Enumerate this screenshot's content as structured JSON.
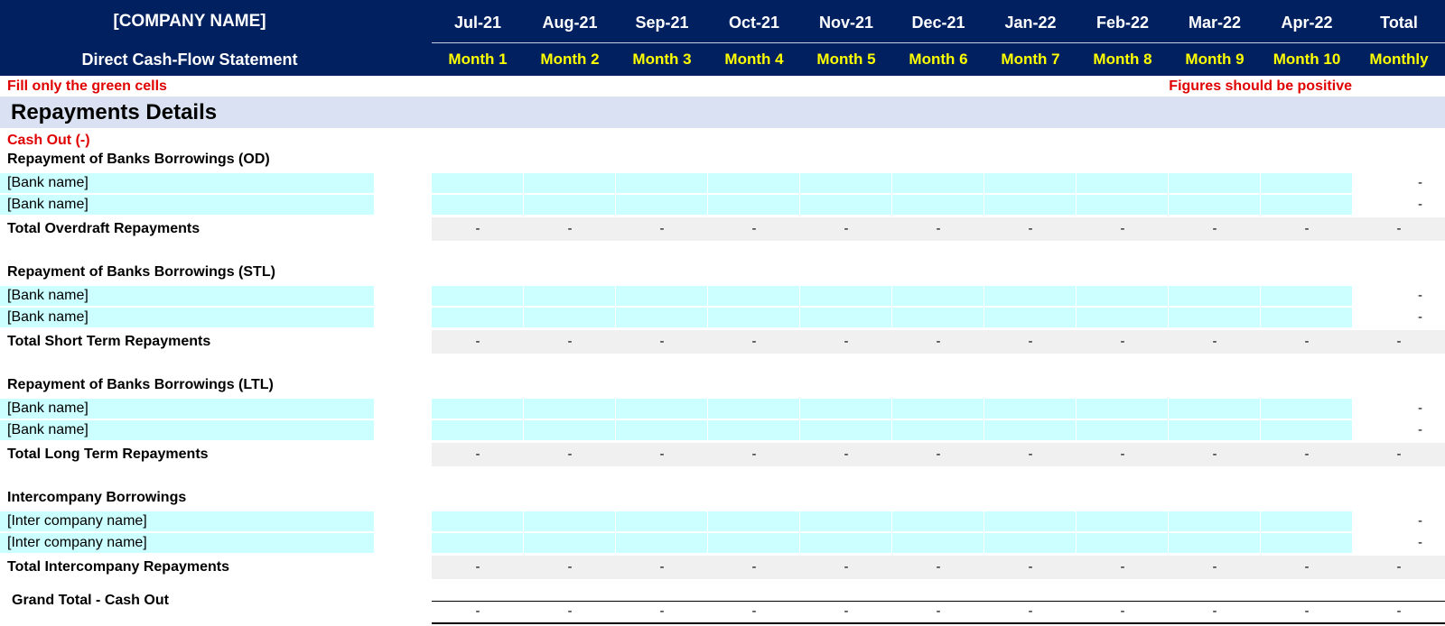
{
  "header": {
    "company": "[COMPANY NAME]",
    "subtitle": "Direct Cash-Flow Statement",
    "months": [
      "Jul-21",
      "Aug-21",
      "Sep-21",
      "Oct-21",
      "Nov-21",
      "Dec-21",
      "Jan-22",
      "Feb-22",
      "Mar-22",
      "Apr-22"
    ],
    "month_numbers": [
      "Month 1",
      "Month 2",
      "Month 3",
      "Month 4",
      "Month 5",
      "Month 6",
      "Month 7",
      "Month 8",
      "Month 9",
      "Month 10"
    ],
    "total_label": "Total",
    "total_sub": "Monthly"
  },
  "notes": {
    "left": "Fill only the green cells",
    "right": "Figures should be positive"
  },
  "section": {
    "title": "Repayments Details",
    "cash_out": "Cash Out (-)"
  },
  "groups": [
    {
      "title": "Repayment of Banks Borrowings (OD)",
      "rows": [
        "[Bank name]",
        "[Bank name]"
      ],
      "total_label": "Total Overdraft Repayments"
    },
    {
      "title": "Repayment of Banks Borrowings (STL)",
      "rows": [
        "[Bank name]",
        "[Bank name]"
      ],
      "total_label": "Total Short Term Repayments"
    },
    {
      "title": "Repayment of Banks Borrowings (LTL)",
      "rows": [
        "[Bank name]",
        "[Bank name]"
      ],
      "total_label": "Total Long Term Repayments"
    },
    {
      "title": "Intercompany Borrowings",
      "rows": [
        "[Inter company name]",
        "[Inter company name]"
      ],
      "total_label": "Total Intercompany Repayments"
    }
  ],
  "grand_total": {
    "label": "Grand Total - Cash Out"
  },
  "empty_value": "-",
  "colors": {
    "header_bg": "#002060",
    "month_number": "#ffff00",
    "input_cell": "#ccffff",
    "total_row_bg": "#f0f0f0",
    "section_band": "#d9e1f2",
    "note_red": "#e00000"
  }
}
